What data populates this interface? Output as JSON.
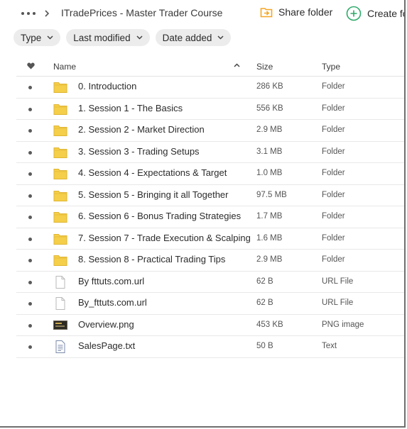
{
  "header": {
    "more_icon": "more-horizontal-icon",
    "separator_icon": "chevron-right-icon",
    "breadcrumb": "ITradePrices - Master Trader Course",
    "share_label": "Share folder",
    "share_icon": "share-folder-icon",
    "create_label": "Create fo",
    "create_icon": "plus-circle-icon"
  },
  "filters": [
    {
      "label": "Type"
    },
    {
      "label": "Last modified"
    },
    {
      "label": "Date added"
    }
  ],
  "columns": {
    "favorite_icon": "heart-icon",
    "name": "Name",
    "sort_icon": "chevron-up-icon",
    "size": "Size",
    "type": "Type"
  },
  "files": [
    {
      "name": "0. Introduction",
      "size": "286 KB",
      "type": "Folder",
      "icon": "folder-icon"
    },
    {
      "name": "1. Session 1 - The Basics",
      "size": "556 KB",
      "type": "Folder",
      "icon": "folder-icon"
    },
    {
      "name": "2. Session 2 - Market Direction",
      "size": "2.9 MB",
      "type": "Folder",
      "icon": "folder-icon"
    },
    {
      "name": "3. Session 3 - Trading Setups",
      "size": "3.1 MB",
      "type": "Folder",
      "icon": "folder-icon"
    },
    {
      "name": "4. Session 4 - Expectations & Target",
      "size": "1.0 MB",
      "type": "Folder",
      "icon": "folder-icon"
    },
    {
      "name": "5. Session 5 - Bringing it all Together",
      "size": "97.5 MB",
      "type": "Folder",
      "icon": "folder-icon"
    },
    {
      "name": "6. Session 6 - Bonus Trading Strategies",
      "size": "1.7 MB",
      "type": "Folder",
      "icon": "folder-icon"
    },
    {
      "name": "7. Session 7 - Trade Execution & Scalping",
      "size": "1.6 MB",
      "type": "Folder",
      "icon": "folder-icon"
    },
    {
      "name": "8. Session 8 - Practical Trading Tips",
      "size": "2.9 MB",
      "type": "Folder",
      "icon": "folder-icon"
    },
    {
      "name": "By fttuts.com.url",
      "size": "62 B",
      "type": "URL File",
      "icon": "file-icon"
    },
    {
      "name": "By_fttuts.com.url",
      "size": "62 B",
      "type": "URL File",
      "icon": "file-icon"
    },
    {
      "name": "Overview.png",
      "size": "453 KB",
      "type": "PNG image",
      "icon": "image-thumbnail-icon"
    },
    {
      "name": "SalesPage.txt",
      "size": "50 B",
      "type": "Text",
      "icon": "text-file-icon"
    }
  ],
  "colors": {
    "folder": "#f5cf4a",
    "share_accent": "#f5a623",
    "create_accent": "#2eaa6a"
  }
}
